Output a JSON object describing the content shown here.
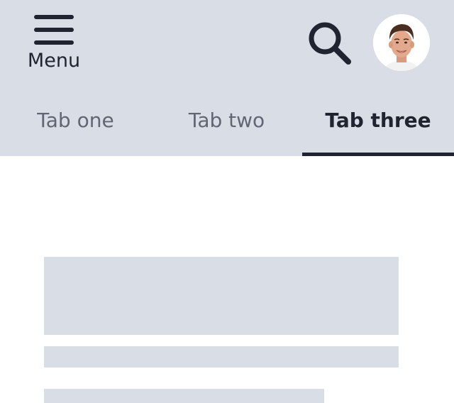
{
  "header": {
    "menu_label": "Menu",
    "colors": {
      "header_background": "#d9dde6",
      "icon_color": "#1f2430",
      "active_tab_text": "#1f2430",
      "inactive_tab_text": "#606673",
      "skeleton_block": "#d9dde6"
    },
    "search_icon": "magnifier",
    "avatar": "user-profile-photo"
  },
  "tabs": [
    {
      "label": "Tab one",
      "active": false
    },
    {
      "label": "Tab two",
      "active": false
    },
    {
      "label": "Tab three",
      "active": true
    }
  ]
}
